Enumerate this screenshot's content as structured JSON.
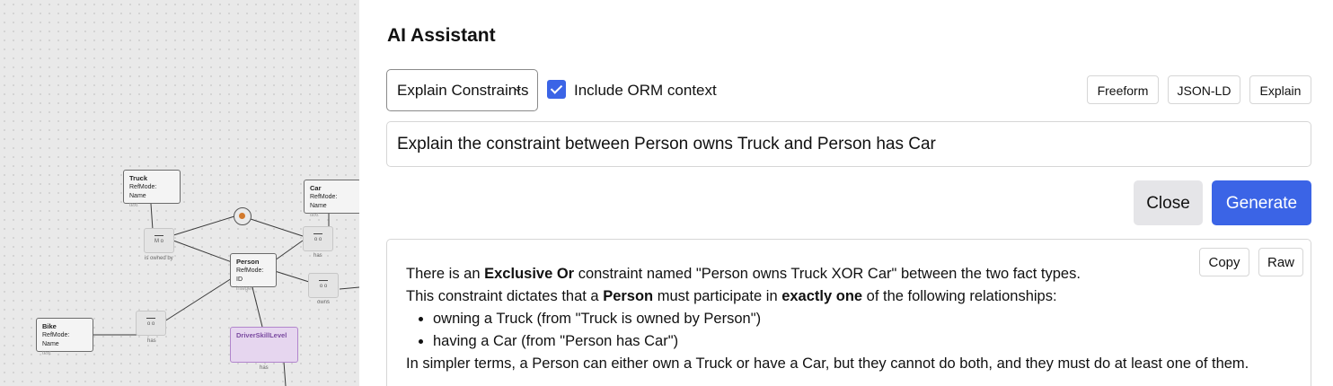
{
  "diagram": {
    "entities": [
      {
        "name": "Truck",
        "refmode": "RefMode: Name",
        "type": "text"
      },
      {
        "name": "Car",
        "refmode": "RefMode: Name",
        "type": "text"
      },
      {
        "name": "Person",
        "refmode": "RefMode: ID",
        "type": "integer"
      },
      {
        "name": "Bike",
        "refmode": "RefMode: Name",
        "type": "text"
      },
      {
        "name": "DriverSkillLevel",
        "refmode": "",
        "type": ""
      }
    ],
    "fact_labels": [
      "is owned by",
      "has",
      "owns",
      "has",
      "has"
    ]
  },
  "assistant": {
    "title": "AI Assistant",
    "mode_select": "Explain Constraints",
    "include_context_label": "Include ORM context",
    "include_context_checked": true,
    "chips": [
      "Freeform",
      "JSON-LD",
      "Explain"
    ],
    "prompt": "Explain the constraint between Person owns Truck and Person has Car",
    "close_label": "Close",
    "generate_label": "Generate",
    "copy_label": "Copy",
    "raw_label": "Raw",
    "response": {
      "line1_a": "There is an ",
      "line1_b": "Exclusive Or",
      "line1_c": " constraint named \"Person owns Truck XOR Car\" between the two fact types.",
      "line2_a": "This constraint dictates that a ",
      "line2_b": "Person",
      "line2_c": " must participate in ",
      "line2_d": "exactly one",
      "line2_e": " of the following relationships:",
      "bullets": [
        "owning a Truck (from \"Truck is owned by Person\")",
        "having a Car (from \"Person has Car\")"
      ],
      "summary": "In simpler terms, a Person can either own a Truck or have a Car, but they cannot do both, and they must do at least one of them."
    }
  },
  "colors": {
    "accent": "#3b64e6",
    "xor_dot": "#d2792c",
    "value_type_border": "#b185cc"
  }
}
